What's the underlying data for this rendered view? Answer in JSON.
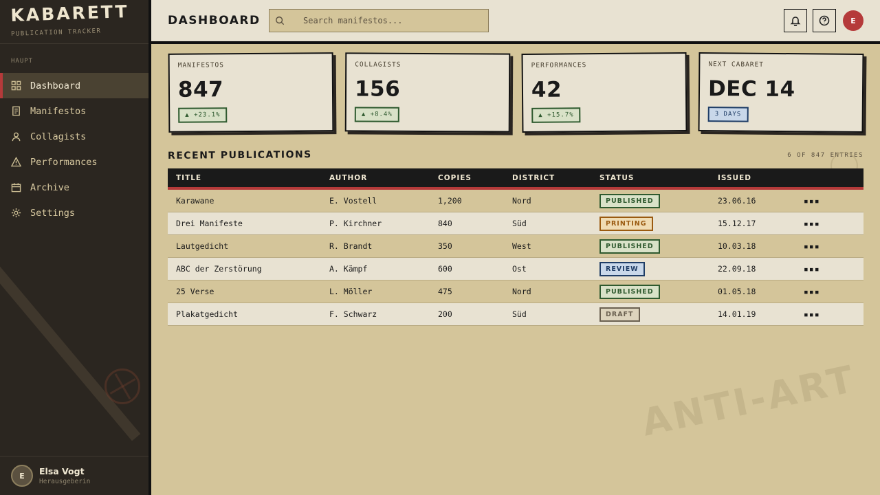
{
  "brand": {
    "title": "KABARETT",
    "subtitle": "PUBLICATION TRACKER"
  },
  "sidebar": {
    "section_label": "HAUPT",
    "items": [
      {
        "label": "Dashboard",
        "icon": "grid-icon",
        "active": true
      },
      {
        "label": "Manifestos",
        "icon": "document-icon"
      },
      {
        "label": "Collagists",
        "icon": "user-icon"
      },
      {
        "label": "Performances",
        "icon": "warning-triangle-icon"
      },
      {
        "label": "Archive",
        "icon": "box-icon"
      },
      {
        "label": "Settings",
        "icon": "gear-icon"
      }
    ],
    "user": {
      "initial": "E",
      "name": "Elsa Vogt",
      "role": "Herausgeberin"
    }
  },
  "header": {
    "title": "DASHBOARD",
    "search_placeholder": "Search manifestos...",
    "avatar_initial": "E"
  },
  "stats": [
    {
      "label": "MANIFESTOS",
      "value": "847",
      "badge": "▲ +23.1%",
      "badge_style": "green"
    },
    {
      "label": "COLLAGISTS",
      "value": "156",
      "badge": "▲ +8.4%",
      "badge_style": "green"
    },
    {
      "label": "PERFORMANCES",
      "value": "42",
      "badge": "▲ +15.7%",
      "badge_style": "green"
    },
    {
      "label": "NEXT CABARET",
      "value": "DEC 14",
      "badge": "3 DAYS",
      "badge_style": "blue"
    }
  ],
  "table": {
    "title": "RECENT PUBLICATIONS",
    "entries_text": "6 OF 847 ENTRIES",
    "columns": [
      "TITLE",
      "AUTHOR",
      "COPIES",
      "DISTRICT",
      "STATUS",
      "ISSUED"
    ],
    "rows": [
      {
        "title": "Karawane",
        "author": "E. Vostell",
        "copies": "1,200",
        "district": "Nord",
        "status": "PUBLISHED",
        "issued": "23.06.16"
      },
      {
        "title": "Drei Manifeste",
        "author": "P. Kirchner",
        "copies": "840",
        "district": "Süd",
        "status": "PRINTING",
        "issued": "15.12.17"
      },
      {
        "title": "Lautgedicht",
        "author": "R. Brandt",
        "copies": "350",
        "district": "West",
        "status": "PUBLISHED",
        "issued": "10.03.18"
      },
      {
        "title": "ABC der Zerstörung",
        "author": "A. Kämpf",
        "copies": "600",
        "district": "Ost",
        "status": "REVIEW",
        "issued": "22.09.18"
      },
      {
        "title": "25 Verse",
        "author": "L. Möller",
        "copies": "475",
        "district": "Nord",
        "status": "PUBLISHED",
        "issued": "01.05.18"
      },
      {
        "title": "Plakatgedicht",
        "author": "F. Schwarz",
        "copies": "200",
        "district": "Süd",
        "status": "DRAFT",
        "issued": "14.01.19"
      }
    ],
    "action_glyph": "▪▪▪"
  },
  "watermark": "ANTI-ART",
  "colors": {
    "accent": "#b53a3a",
    "sidebar": "#2b2620",
    "background": "#d4c59a",
    "card": "#e8e2d2"
  }
}
